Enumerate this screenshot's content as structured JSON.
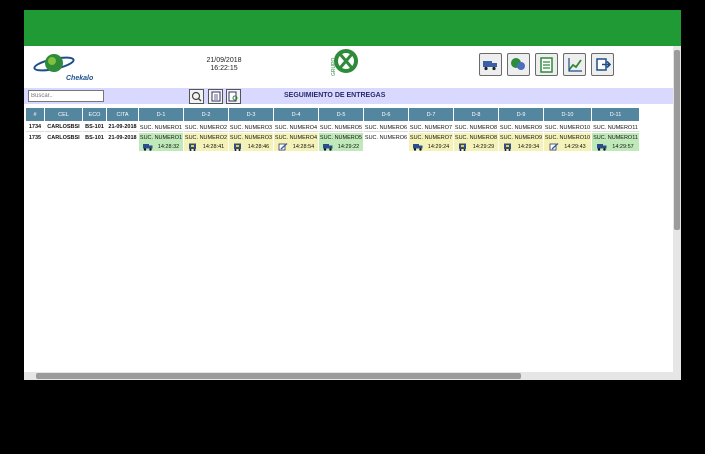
{
  "header": {
    "date": "21/09/2018",
    "time": "16:22:15"
  },
  "logo": {
    "text": "Chekalo"
  },
  "grupo": {
    "text": "GRUPO"
  },
  "search": {
    "placeholder": "Buscar.."
  },
  "screen_title": "SEGUIMIENTO DE ENTREGAS",
  "colors": {
    "topbar": "#1f9a35",
    "header_cell": "#5486a0",
    "green_cell": "#bfe9b8",
    "yellow_cell": "#f5f2b8",
    "search_bg": "#d9d9ff"
  },
  "columns": [
    "#",
    "CEL",
    "ECO",
    "CITA",
    "D-1",
    "D-2",
    "D-3",
    "D-4",
    "D-5",
    "D-6",
    "D-7",
    "D-8",
    "D-9",
    "D-10",
    "D-11"
  ],
  "rows": [
    {
      "id": "1734",
      "cel": "CARLOSBSI",
      "eco": "BS-101",
      "cita": "21-09-2018",
      "cells": [
        {
          "name": "SUC. NUMERO1"
        },
        {
          "name": "SUC. NUMERO2"
        },
        {
          "name": "SUC. NUMERO3"
        },
        {
          "name": "SUC. NUMERO4"
        },
        {
          "name": "SUC. NUMERO5"
        },
        {
          "name": "SUC. NUMERO6"
        },
        {
          "name": "SUC. NUMERO7"
        },
        {
          "name": "SUC. NUMERO8"
        },
        {
          "name": "SUC. NUMERO9"
        },
        {
          "name": "SUC. NUMERO10"
        },
        {
          "name": "SUC. NUMERO11"
        }
      ]
    },
    {
      "id": "1735",
      "cel": "CARLOSBSI",
      "eco": "BS-101",
      "cita": "21-09-2018",
      "cells": [
        {
          "name": "SUC. NUMERO1",
          "time": "14:28:32",
          "status": "green",
          "icon": "truck-icon"
        },
        {
          "name": "SUC. NUMERO2",
          "time": "14:28:41",
          "status": "yellow",
          "icon": "delivery-icon"
        },
        {
          "name": "SUC. NUMERO3",
          "time": "14:28:46",
          "status": "yellow",
          "icon": "delivery-icon"
        },
        {
          "name": "SUC. NUMERO4",
          "time": "14:28:54",
          "status": "yellow",
          "icon": "document-icon"
        },
        {
          "name": "SUC. NUMERO5",
          "time": "14:29:22",
          "status": "green",
          "icon": "truck-icon"
        },
        {
          "name": "SUC. NUMERO6",
          "time": "",
          "status": "blank",
          "icon": ""
        },
        {
          "name": "SUC. NUMERO7",
          "time": "14:29:24",
          "status": "yellow",
          "icon": "truck-icon"
        },
        {
          "name": "SUC. NUMERO8",
          "time": "14:29:29",
          "status": "yellow",
          "icon": "delivery-icon"
        },
        {
          "name": "SUC. NUMERO9",
          "time": "14:29:34",
          "status": "yellow",
          "icon": "delivery-icon"
        },
        {
          "name": "SUC. NUMERO10",
          "time": "14:29:43",
          "status": "yellow",
          "icon": "document-icon"
        },
        {
          "name": "SUC. NUMERO11",
          "time": "14:29:57",
          "status": "green",
          "icon": "truck-icon"
        }
      ]
    }
  ]
}
